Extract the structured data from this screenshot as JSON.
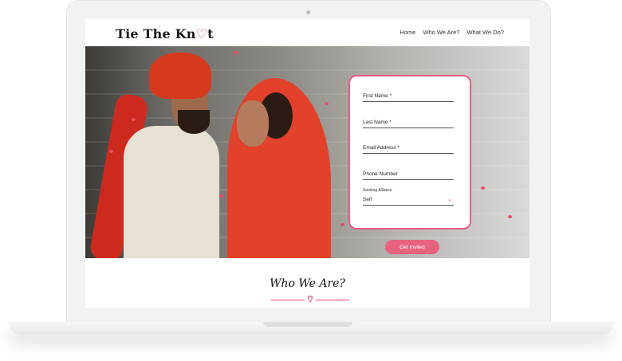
{
  "brand": {
    "name_prefix": "Tie The Kn",
    "name_suffix": "t",
    "heart_glyph": "♡"
  },
  "nav": [
    "Home",
    "Who We Are?",
    "What We Do?"
  ],
  "form": {
    "first_name": "First Name *",
    "last_name": "Last Name *",
    "email": "Email Address *",
    "phone": "Phone Number",
    "seeking_label": "Seeking Alliance",
    "seeking_value": "Self",
    "submit": "Get Invited"
  },
  "section": {
    "title": "Who We Are?"
  },
  "colors": {
    "accent": "#e2446c",
    "button": "#e6637f",
    "laptop": "#f2f2f2"
  }
}
